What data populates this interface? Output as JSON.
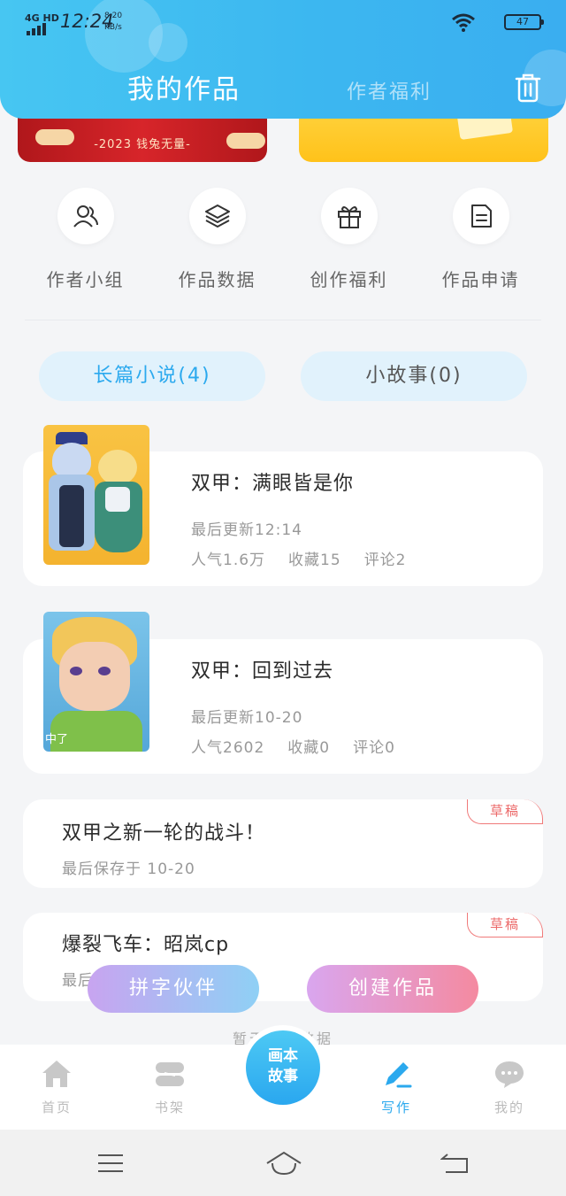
{
  "status_bar": {
    "network": "4G HD",
    "time": "12:24",
    "speed_value": "8.20",
    "speed_unit": "KB/s",
    "battery": "47"
  },
  "header": {
    "tab_active": "我的作品",
    "tab_other": "作者福利",
    "trash_icon": "trash-icon"
  },
  "banners": {
    "left_text": "-2023 钱兔无量-"
  },
  "quick_links": [
    {
      "label": "作者小组",
      "icon": "group-icon"
    },
    {
      "label": "作品数据",
      "icon": "layers-icon"
    },
    {
      "label": "创作福利",
      "icon": "gift-icon"
    },
    {
      "label": "作品申请",
      "icon": "document-icon"
    }
  ],
  "categories": [
    {
      "label": "长篇小说(4)",
      "active": true
    },
    {
      "label": "小故事(0)",
      "active": false
    }
  ],
  "works": [
    {
      "title": "双甲：满眼皆是你",
      "updated": "最后更新12:14",
      "popularity": "人气1.6万",
      "favorites": "收藏15",
      "comments": "评论2"
    },
    {
      "title": "双甲：回到过去",
      "updated": "最后更新10-20",
      "popularity": "人气2602",
      "favorites": "收藏0",
      "comments": "评论0",
      "cover_label": "中了"
    }
  ],
  "drafts": [
    {
      "title": "双甲之新一轮的战斗！",
      "saved": "最后保存于 10-20",
      "badge": "草稿"
    },
    {
      "title": "爆裂飞车：昭岚cp",
      "saved": "最后",
      "badge": "草稿"
    }
  ],
  "floating_buttons": {
    "partner": "拼字伙伴",
    "create": "创建作品"
  },
  "empty_hint": "暂无更多数据",
  "bottom_nav": [
    {
      "label": "首页",
      "icon": "home-icon"
    },
    {
      "label": "书架",
      "icon": "bookshelf-icon"
    },
    {
      "label": "写作",
      "icon": "pencil-icon",
      "active": true
    },
    {
      "label": "我的",
      "icon": "chat-icon"
    }
  ],
  "center_button": {
    "line1": "画本",
    "line2": "故事"
  },
  "colors": {
    "accent": "#2ba9ee",
    "header": "#3cb7f0",
    "draft": "#ec6a6a"
  }
}
